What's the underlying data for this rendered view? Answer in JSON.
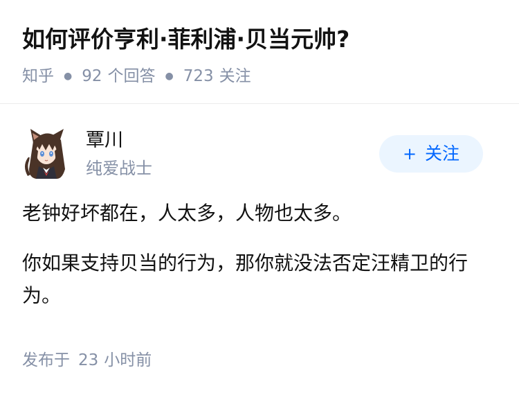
{
  "question": {
    "title": "如何评价亨利·菲利浦·贝当元帅?",
    "source": "知乎",
    "answer_count": "92",
    "answer_label": "个回答",
    "follow_count": "723",
    "follow_label": "关注"
  },
  "author": {
    "name": "覃川",
    "bio": "纯爱战士",
    "avatar_icon": "anime-girl-avatar"
  },
  "follow_button": {
    "plus": "+",
    "label": "关注"
  },
  "answer": {
    "paragraphs": [
      "老钟好坏都在，人太多，人物也太多。",
      "你如果支持贝当的行为，那你就没法否定汪精卫的行为。"
    ],
    "time_prefix": "发布于",
    "time_value": "23",
    "time_suffix": "小时前"
  },
  "colors": {
    "text_primary": "#121212",
    "text_secondary": "#8590a6",
    "accent": "#0066ff",
    "button_bg": "#ebf5ff"
  }
}
